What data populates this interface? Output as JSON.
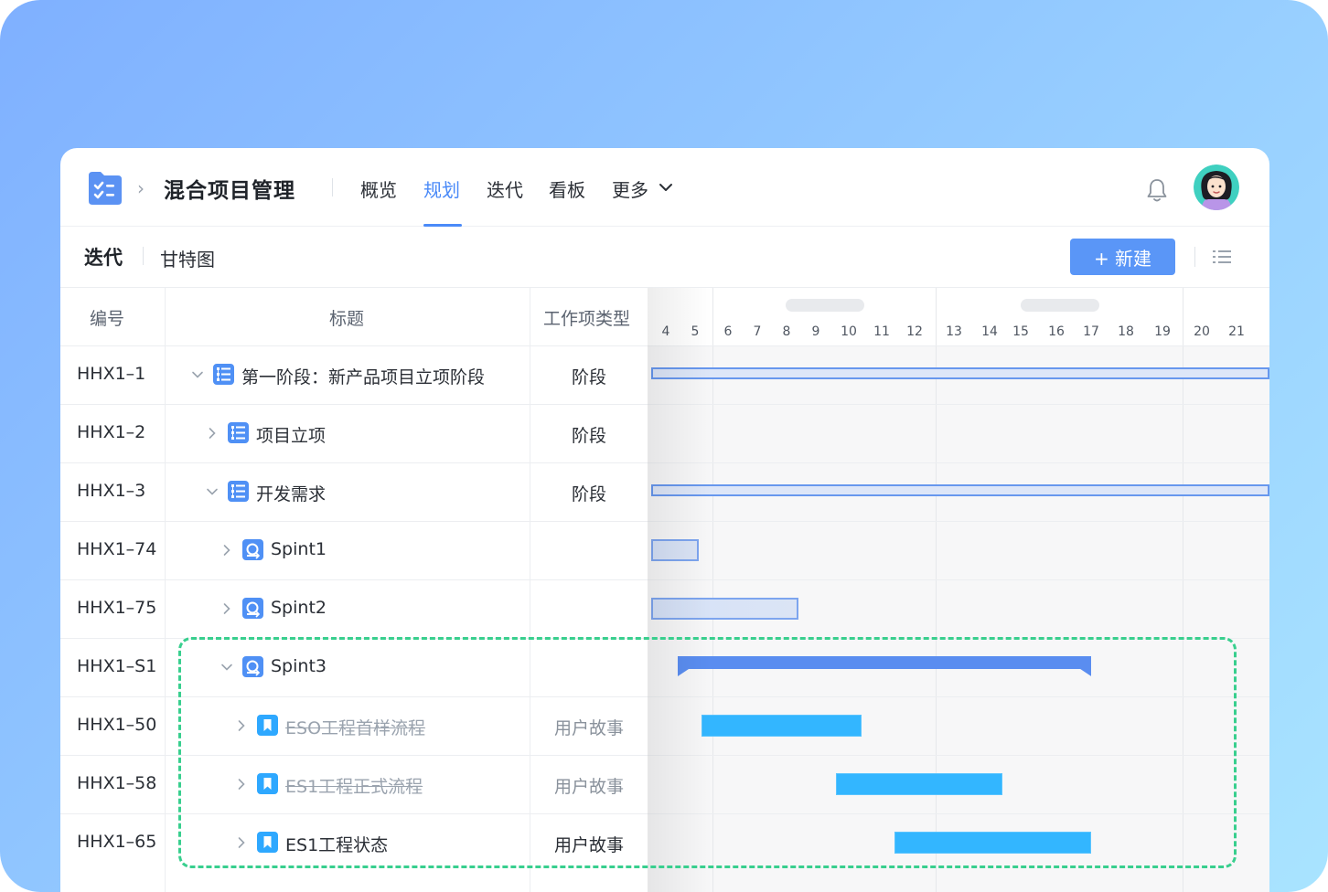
{
  "header": {
    "app_title": "混合项目管理",
    "nav": [
      "概览",
      "规划",
      "迭代",
      "看板",
      "更多"
    ],
    "active_nav": "规划"
  },
  "toolbar": {
    "section": "迭代",
    "view": "甘特图",
    "new_button": "+ 新建"
  },
  "table": {
    "columns": [
      "编号",
      "标题",
      "工作项类型"
    ],
    "rows": [
      {
        "id": "HHX1–1",
        "title": "第一阶段：新产品项目立项阶段",
        "type": "阶段",
        "icon": "stage-icon",
        "expanded": true,
        "done": false
      },
      {
        "id": "HHX1–2",
        "title": "项目立项",
        "type": "阶段",
        "icon": "stage-icon",
        "expanded": false,
        "done": false
      },
      {
        "id": "HHX1–3",
        "title": "开发需求",
        "type": "阶段",
        "icon": "stage-icon",
        "expanded": true,
        "done": false
      },
      {
        "id": "HHX1–74",
        "title": "Spint1",
        "type": "",
        "icon": "sprint-icon",
        "expanded": false,
        "done": false
      },
      {
        "id": "HHX1–75",
        "title": "Spint2",
        "type": "",
        "icon": "sprint-icon",
        "expanded": false,
        "done": false
      },
      {
        "id": "HHX1–S1",
        "title": "Spint3",
        "type": "",
        "icon": "sprint-icon",
        "expanded": true,
        "done": false
      },
      {
        "id": "HHX1–50",
        "title": "ESO工程首样流程",
        "type": "用户故事",
        "icon": "story-icon",
        "expanded": false,
        "done": true
      },
      {
        "id": "HHX1–58",
        "title": "ES1工程正式流程",
        "type": "用户故事",
        "icon": "story-icon",
        "expanded": false,
        "done": true
      },
      {
        "id": "HHX1–65",
        "title": "ES1工程状态",
        "type": "用户故事",
        "icon": "story-icon",
        "expanded": false,
        "done": false
      }
    ]
  },
  "gantt": {
    "days": [
      "4",
      "5",
      "6",
      "7",
      "8",
      "9",
      "10",
      "11",
      "12",
      "13",
      "14",
      "15",
      "16",
      "17",
      "18",
      "19",
      "20",
      "21"
    ],
    "bars": [
      {
        "row": 0,
        "kind": "stage",
        "start": 3.5,
        "end": 22
      },
      {
        "row": 2,
        "kind": "stage",
        "start": 3.5,
        "end": 22
      },
      {
        "row": 3,
        "kind": "sprint",
        "start": 3.5,
        "end": 5.1
      },
      {
        "row": 4,
        "kind": "sprint",
        "start": 3.5,
        "end": 8.4
      },
      {
        "row": 5,
        "kind": "summary",
        "start": 4.4,
        "end": 17
      },
      {
        "row": 6,
        "kind": "story",
        "start": 5.2,
        "end": 10.4
      },
      {
        "row": 7,
        "kind": "story",
        "start": 9.6,
        "end": 14.4
      },
      {
        "row": 8,
        "kind": "story",
        "start": 11.4,
        "end": 17
      }
    ]
  },
  "colors": {
    "accent": "#4a8af8",
    "story_bar": "#33b6ff",
    "highlight_dash": "#38cf8e"
  }
}
